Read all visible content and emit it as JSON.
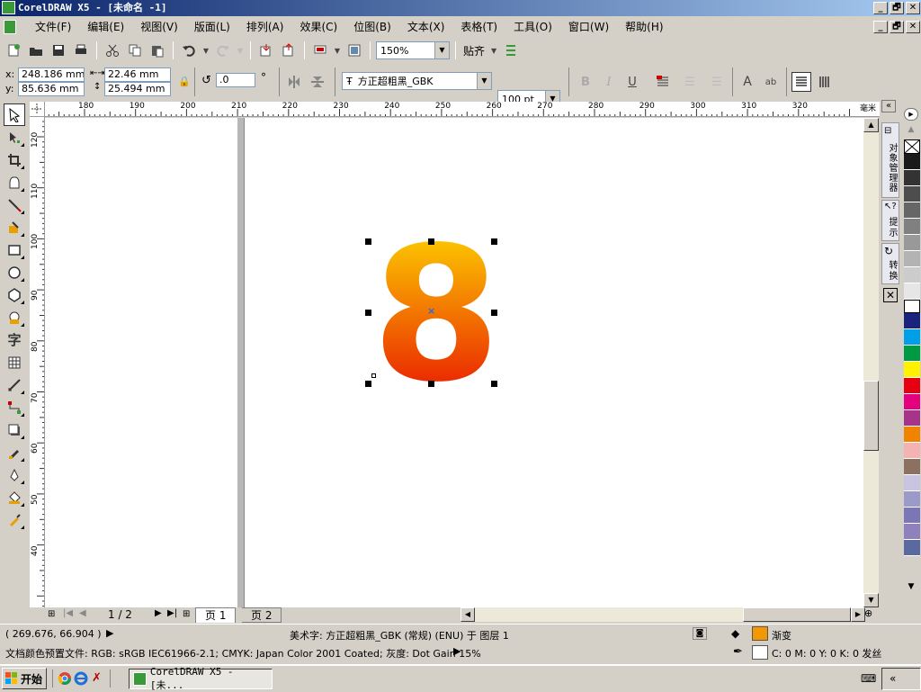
{
  "app": {
    "title": "CorelDRAW X5 - [未命名 -1]",
    "title_buttons": [
      "_",
      "🗗",
      "✕"
    ],
    "doc_buttons": [
      "_",
      "🗗",
      "✕"
    ]
  },
  "menu": {
    "items": [
      "文件(F)",
      "编辑(E)",
      "视图(V)",
      "版面(L)",
      "排列(A)",
      "效果(C)",
      "位图(B)",
      "文本(X)",
      "表格(T)",
      "工具(O)",
      "窗口(W)",
      "帮助(H)"
    ]
  },
  "standard_toolbar": {
    "zoom_level": "150%",
    "snap_label": "贴齐"
  },
  "property_bar": {
    "x_label": "x:",
    "x_value": "248.186 mm",
    "y_label": "y:",
    "y_value": "85.636 mm",
    "width_value": "22.46 mm",
    "height_value": "25.494 mm",
    "rotation_value": ".0",
    "degree_symbol": "°",
    "font_name": "方正超粗黑_GBK",
    "font_size": "100 pt"
  },
  "rulers": {
    "h_ticks": [
      "180",
      "190",
      "200",
      "210",
      "220",
      "230",
      "240",
      "250",
      "260",
      "270",
      "280",
      "290",
      "300",
      "310",
      "320"
    ],
    "h_unit": "毫米",
    "v_ticks": [
      "120",
      "110",
      "100",
      "90",
      "80",
      "70",
      "60",
      "50",
      "40"
    ]
  },
  "canvas": {
    "artistic_text": "8",
    "gradient_top": "#FFE600",
    "gradient_bottom": "#E60000",
    "selection_center_color": "#1e6fd9"
  },
  "docker": {
    "tabs": [
      "对象管理器",
      "提示",
      "转换"
    ]
  },
  "palette": {
    "colors": [
      "#1a1a1a",
      "#333333",
      "#4d4d4d",
      "#666666",
      "#808080",
      "#999999",
      "#b3b3b3",
      "#cccccc",
      "#e6e6e6",
      "#ffffff",
      "#1a237e",
      "#00a0e9",
      "#009944",
      "#fff100",
      "#e60012",
      "#e4007f",
      "#a73489",
      "#f08300",
      "#f5b2b2",
      "#8c7060",
      "#c9c5e0",
      "#9c9ac8",
      "#7b77b6",
      "#8f82bc",
      "#5a6aa0"
    ]
  },
  "page_nav": {
    "page_counter": "1 / 2",
    "page_tabs": [
      "页 1",
      "页 2"
    ]
  },
  "status": {
    "cursor_position": "( 269.676, 66.904 )",
    "object_info": "美术字: 方正超粗黑_GBK (常规) (ENU) 于 图层 1",
    "fill_label": "渐变",
    "fill_color": "#f39800",
    "color_profile": "文档颜色预置文件: RGB: sRGB IEC61966-2.1; CMYK: Japan Color 2001 Coated; 灰度: Dot Gain 15%",
    "outline_label": "C: 0 M: 0 Y: 0 K: 0 发丝"
  },
  "taskbar": {
    "start_label": "开始",
    "task_label": "CorelDRAW X5 - [未...",
    "tray_label": "«"
  }
}
